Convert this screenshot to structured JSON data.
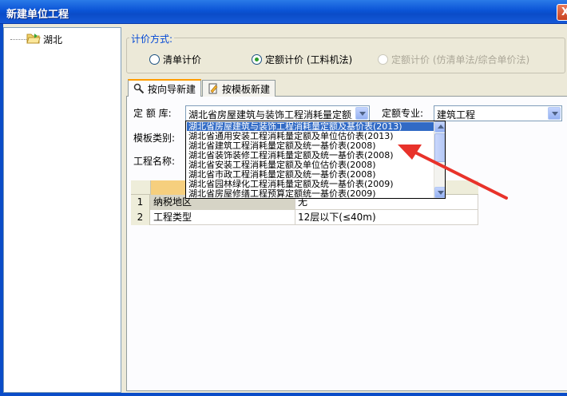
{
  "window": {
    "title": "新建单位工程",
    "close_label": "X"
  },
  "tree": {
    "root_label": "湖北",
    "root_icon": "open-folder-icon"
  },
  "pricing": {
    "legend": "计价方式:",
    "options": [
      {
        "label": "清单计价",
        "selected": false,
        "disabled": false
      },
      {
        "label": "定额计价 (工料机法)",
        "selected": true,
        "disabled": false
      },
      {
        "label": "定额计价 (仿清单法/综合单价法)",
        "selected": false,
        "disabled": true
      }
    ]
  },
  "tabs": [
    {
      "label": "按向导新建",
      "icon": "wizard-icon",
      "active": true
    },
    {
      "label": "按模板新建",
      "icon": "template-icon",
      "active": false
    }
  ],
  "form": {
    "quota_lib_label": "定 额 库:",
    "quota_lib_value": "湖北省房屋建筑与装饰工程消耗量定额及基价表(2013)",
    "quota_major_label": "定额专业:",
    "quota_major_value": "建筑工程",
    "template_type_label": "模板类别:",
    "project_name_label": "工程名称:"
  },
  "dropdown": {
    "items": [
      "湖北省房屋建筑与装饰工程消耗量定额及基价表(2013)",
      "湖北省通用安装工程消耗量定额及单位估价表(2013)",
      "湖北省建筑工程消耗量定额及统一基价表(2008)",
      "湖北省装饰装修工程消耗量定额及统一基价表(2008)",
      "湖北省安装工程消耗量定额及单位估价表(2008)",
      "湖北省市政工程消耗量定额及统一基价表(2008)",
      "湖北省园林绿化工程消耗量定额及统一基价表(2009)",
      "湖北省房屋修缮工程预算定额统一基价表(2009)"
    ],
    "selected_index": 0
  },
  "grid": {
    "rows": [
      {
        "num": "1",
        "key": "纳税地区",
        "value": "无"
      },
      {
        "num": "2",
        "key": "工程类型",
        "value": "12层以下(≤40m)"
      }
    ]
  },
  "colors": {
    "title_bar": "#0a4cc8",
    "selection": "#316ac5",
    "annotation_arrow": "#e8322a"
  }
}
